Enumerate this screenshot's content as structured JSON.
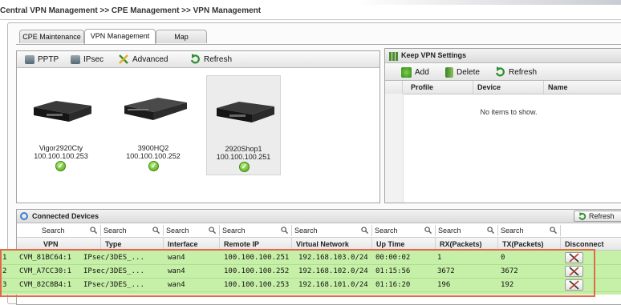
{
  "breadcrumb": "Central VPN Management >> CPE Management >> VPN Management",
  "tabs": [
    {
      "label": "CPE Maintenance",
      "active": false
    },
    {
      "label": "VPN Management",
      "active": true
    },
    {
      "label": "Map",
      "active": false
    }
  ],
  "vpn_toolbar": {
    "pptp": "PPTP",
    "ipsec": "IPsec",
    "advanced": "Advanced",
    "refresh": "Refresh"
  },
  "devices": [
    {
      "name": "Vigor2920Cty",
      "ip": "100.100.100.253",
      "selected": false
    },
    {
      "name": "3900HQ2",
      "ip": "100.100.100.252",
      "selected": false
    },
    {
      "name": "2920Shop1",
      "ip": "100.100.100.251",
      "selected": true
    }
  ],
  "keep_vpn": {
    "title": "Keep VPN Settings",
    "add": "Add",
    "delete": "Delete",
    "refresh": "Refresh",
    "columns": [
      "Profile",
      "Device",
      "Name"
    ],
    "empty": "No items to show."
  },
  "connected": {
    "title": "Connected Devices",
    "refresh": "Refresh",
    "search_placeholder": "Search",
    "columns": [
      "VPN",
      "Type",
      "Interface",
      "Remote IP",
      "Virtual Network",
      "Up Time",
      "RX(Packets)",
      "TX(Packets)",
      "Disconnect"
    ],
    "rows": [
      {
        "num": "1",
        "vpn": "CVM_81BC64:1",
        "type": "IPsec/3DES_...",
        "iface": "wan4",
        "remote": "100.100.100.251",
        "vnet": "192.168.103.0/24",
        "uptime": "00:00:02",
        "rx": "1",
        "tx": "0"
      },
      {
        "num": "2",
        "vpn": "CVM_A7CC30:1",
        "type": "IPsec/3DES_...",
        "iface": "wan4",
        "remote": "100.100.100.252",
        "vnet": "192.168.102.0/24",
        "uptime": "01:15:56",
        "rx": "3672",
        "tx": "3672"
      },
      {
        "num": "3",
        "vpn": "CVM_82C8B4:1",
        "type": "IPsec/3DES_...",
        "iface": "wan4",
        "remote": "100.100.100.253",
        "vnet": "192.168.101.0/24",
        "uptime": "01:16:20",
        "rx": "196",
        "tx": "192"
      }
    ]
  },
  "colors": {
    "row_green": "#c6f0a8",
    "highlight_border": "#e06a4a",
    "check_green": "#4ea315"
  }
}
